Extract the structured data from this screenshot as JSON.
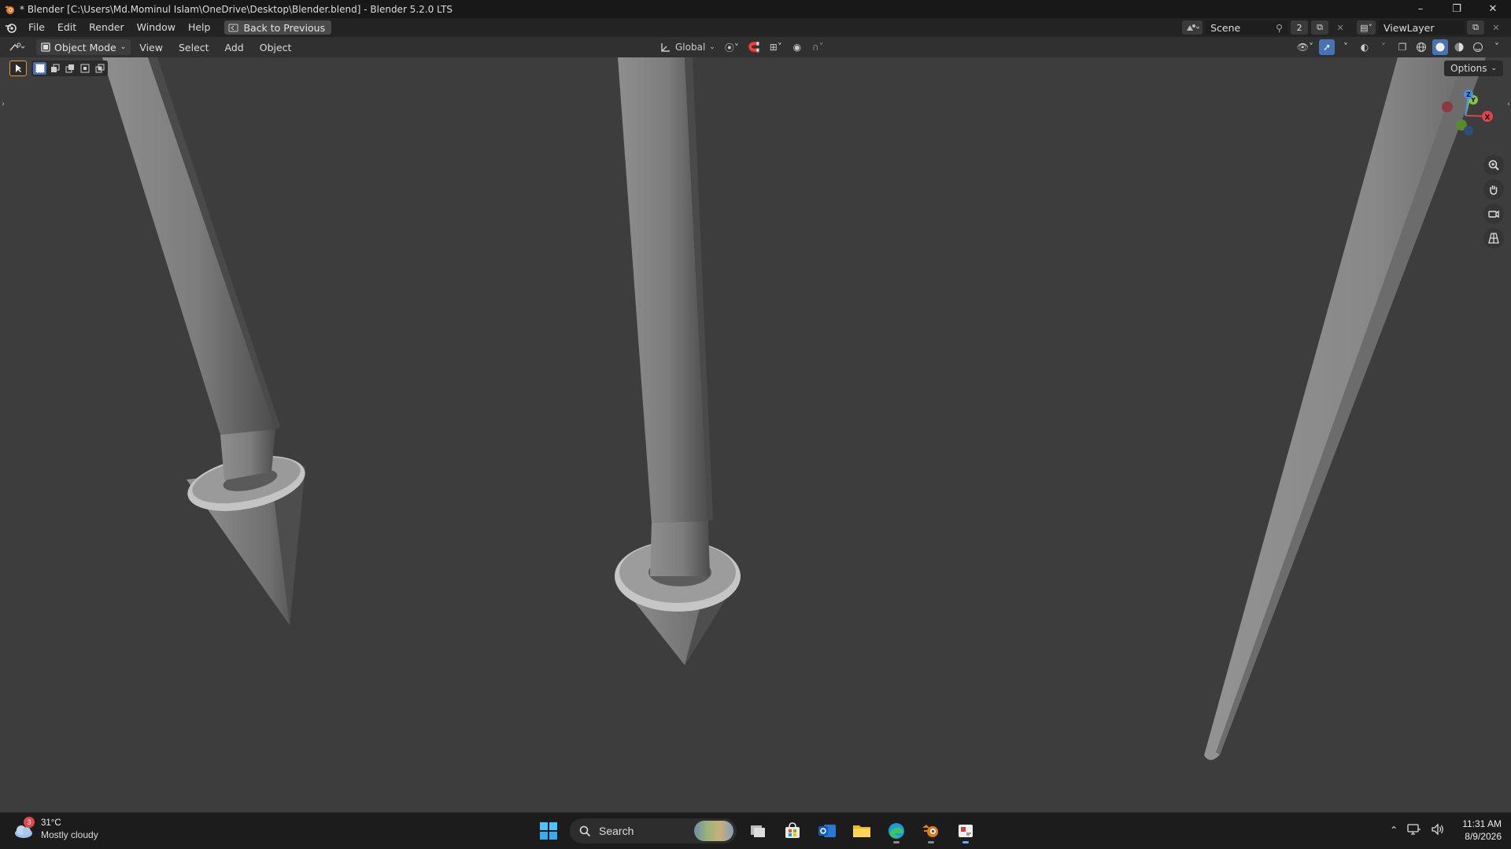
{
  "window": {
    "title": "* Blender [C:\\Users\\Md.Mominul Islam\\OneDrive\\Desktop\\Blender.blend] - Blender 5.2.0 LTS",
    "minimize_icon": "minimize-icon",
    "maximize_icon": "restore-icon",
    "close_icon": "close-icon"
  },
  "topbar": {
    "menus": [
      "File",
      "Edit",
      "Render",
      "Window",
      "Help"
    ],
    "back_button": "Back to Previous",
    "scene_name": "Scene",
    "scene_count": "2",
    "view_layer": "ViewLayer"
  },
  "viewport_header": {
    "mode": "Object Mode",
    "menus": [
      "View",
      "Select",
      "Add",
      "Object"
    ],
    "transform_orientation": "Global",
    "options_label": "Options"
  },
  "gizmo": {
    "x_label": "X",
    "y_label": "Y",
    "z_label": "Z",
    "colors": {
      "x": "#e0434f",
      "y": "#8bc34a",
      "z": "#4a90e2"
    }
  },
  "taskbar": {
    "weather_badge": "3",
    "temperature": "31°C",
    "condition": "Mostly cloudy",
    "search_placeholder": "Search",
    "time": "11:31 AM",
    "date": "8/9/2026"
  },
  "colors": {
    "viewport_bg": "#3d3d3d",
    "header_bg": "#303030",
    "accent": "#4772b3",
    "active_tool": "#e09a3c"
  }
}
